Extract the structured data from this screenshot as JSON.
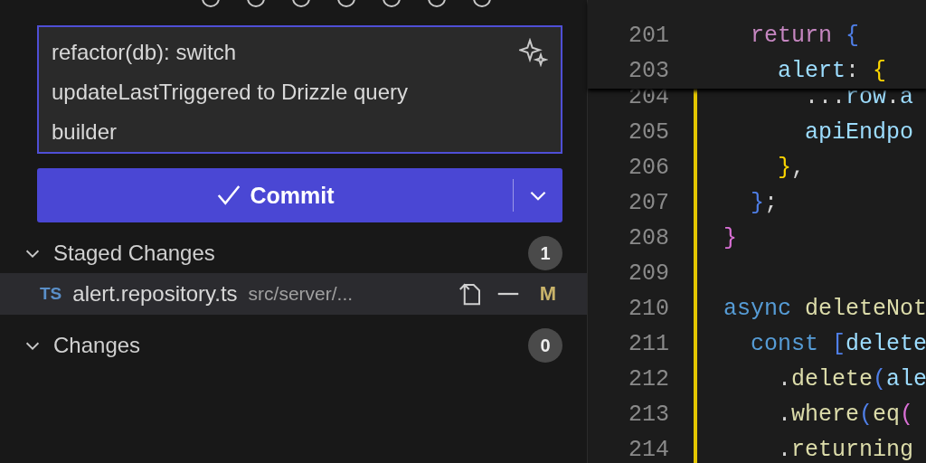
{
  "scm": {
    "message": {
      "value": "refactor(db): switch updateLastTriggered to Drizzle query builder"
    },
    "commit_button": {
      "label": "Commit"
    },
    "groups": [
      {
        "label": "Staged Changes",
        "count": "1",
        "expanded": true,
        "files": [
          {
            "type_badge": "TS",
            "name": "alert.repository.ts",
            "path": "src/server/...",
            "status": "M",
            "selected": true
          }
        ]
      },
      {
        "label": "Changes",
        "count": "0",
        "expanded": true
      }
    ]
  },
  "editor": {
    "sticky_lines": [
      {
        "number": "201",
        "tokens": [
          {
            "text": "  return",
            "kind": "keyword"
          },
          {
            "text": " {",
            "kind": "bracket2"
          }
        ]
      },
      {
        "number": "203",
        "tokens": [
          {
            "text": "    alert",
            "kind": "prop"
          },
          {
            "text": ":",
            "kind": "punct"
          },
          {
            "text": " {",
            "kind": "bracket1"
          }
        ]
      }
    ],
    "lines": [
      {
        "number": "204",
        "tokens": [
          {
            "text": "      ...",
            "kind": "punct"
          },
          {
            "text": "row",
            "kind": "prop"
          },
          {
            "text": ".",
            "kind": "punct"
          },
          {
            "text": "a",
            "kind": "prop"
          }
        ]
      },
      {
        "number": "205",
        "tokens": [
          {
            "text": "      apiEndpo",
            "kind": "prop"
          }
        ]
      },
      {
        "number": "206",
        "tokens": [
          {
            "text": "    }",
            "kind": "bracket1"
          },
          {
            "text": ",",
            "kind": "punct"
          }
        ]
      },
      {
        "number": "207",
        "tokens": [
          {
            "text": "  }",
            "kind": "bracket2"
          },
          {
            "text": ";",
            "kind": "punct"
          }
        ]
      },
      {
        "number": "208",
        "tokens": [
          {
            "text": "}",
            "kind": "bracket3"
          }
        ]
      },
      {
        "number": "209"
      },
      {
        "number": "210",
        "tokens": [
          {
            "text": "async",
            "kind": "decl"
          },
          {
            "text": " deleteNot",
            "kind": "func"
          }
        ]
      },
      {
        "number": "211",
        "tokens": [
          {
            "text": "  const",
            "kind": "decl"
          },
          {
            "text": " [",
            "kind": "bracket2"
          },
          {
            "text": "delete",
            "kind": "prop"
          }
        ]
      },
      {
        "number": "212",
        "tokens": [
          {
            "text": "    .",
            "kind": "punct"
          },
          {
            "text": "delete",
            "kind": "func"
          },
          {
            "text": "(",
            "kind": "bracket2"
          },
          {
            "text": "ale",
            "kind": "prop"
          }
        ]
      },
      {
        "number": "213",
        "tokens": [
          {
            "text": "    .",
            "kind": "punct"
          },
          {
            "text": "where",
            "kind": "func"
          },
          {
            "text": "(",
            "kind": "bracket2"
          },
          {
            "text": "eq",
            "kind": "func"
          },
          {
            "text": "(",
            "kind": "bracket3"
          }
        ]
      },
      {
        "number": "214",
        "tokens": [
          {
            "text": "    .",
            "kind": "punct"
          },
          {
            "text": "returning",
            "kind": "func"
          }
        ]
      }
    ]
  }
}
